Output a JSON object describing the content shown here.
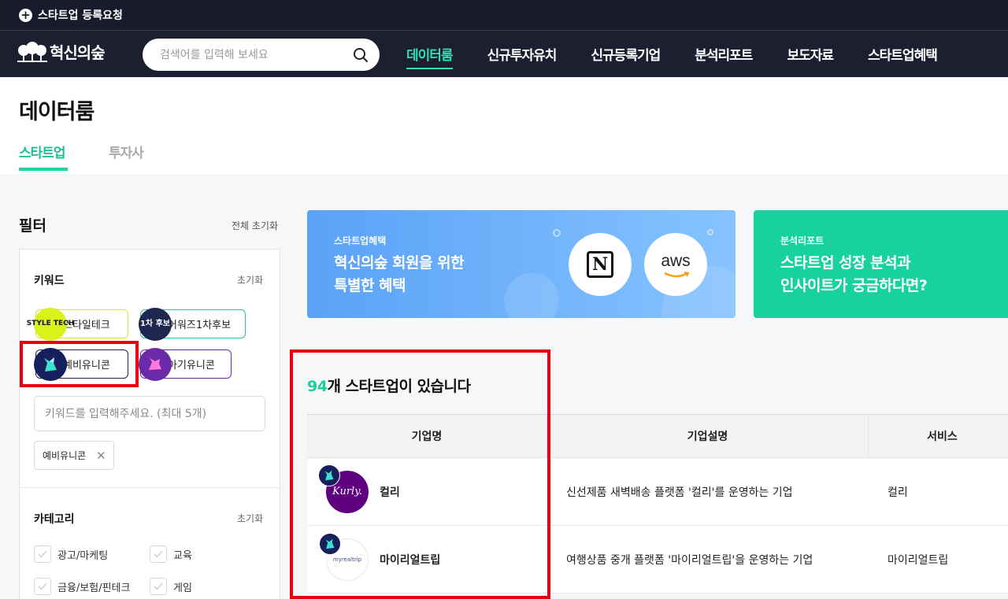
{
  "topbar": {
    "register_label": "스타트업 등록요청"
  },
  "gnb": {
    "logo_text": "혁신의숲",
    "search_placeholder": "검색어를 입력해 보세요",
    "nav": [
      "데이터룸",
      "신규투자유치",
      "신규등록기업",
      "분석리포트",
      "보도자료",
      "스타트업혜택"
    ]
  },
  "header": {
    "title": "데이터룸",
    "tabs": [
      "스타트업",
      "투자사"
    ]
  },
  "filter": {
    "title": "필터",
    "reset_all": "전체 초기화",
    "keyword": {
      "label": "키워드",
      "reset": "초기화",
      "chips": [
        {
          "label": "스타일테크",
          "badge": "STYLE TECH"
        },
        {
          "label": "어워즈1차후보",
          "badge": "1차 후보"
        },
        {
          "label": "예비유니콘"
        },
        {
          "label": "아기유니콘"
        }
      ],
      "input_placeholder": "키워드를 입력해주세요. (최대 5개)",
      "selected": "예비유니콘"
    },
    "category": {
      "label": "카테고리",
      "reset": "초기화",
      "items": [
        "광고/마케팅",
        "교육",
        "금융/보험/핀테크",
        "게임"
      ]
    }
  },
  "banners": [
    {
      "tag": "스타트업혜택",
      "line1": "혁신의숲 회원을 위한",
      "line2": "특별한 혜택",
      "logo1": "N",
      "logo2": "aws"
    },
    {
      "tag": "분석리포트",
      "line1": "스타트업 성장 분석과",
      "line2": "인사이트가 궁금하다면?"
    }
  ],
  "results": {
    "count": "94",
    "suffix": "개 스타트업이 있습니다"
  },
  "table": {
    "headers": [
      "기업명",
      "기업설명",
      "서비스"
    ],
    "rows": [
      {
        "name": "컬리",
        "logo": "Kurly.",
        "desc": "신선제품 새벽배송 플랫폼 '컬리'를 운영하는 기업",
        "service": "컬리"
      },
      {
        "name": "마이리얼트립",
        "logo": "myrealtrip",
        "desc": "여행상품 중개 플랫폼 '마이리얼트립'을 운영하는 기업",
        "service": "마이리얼트립"
      }
    ]
  },
  "colors": {
    "accent": "#1fd4a4",
    "nav_bg": "#1b1f30",
    "highlight": "#e60012"
  }
}
